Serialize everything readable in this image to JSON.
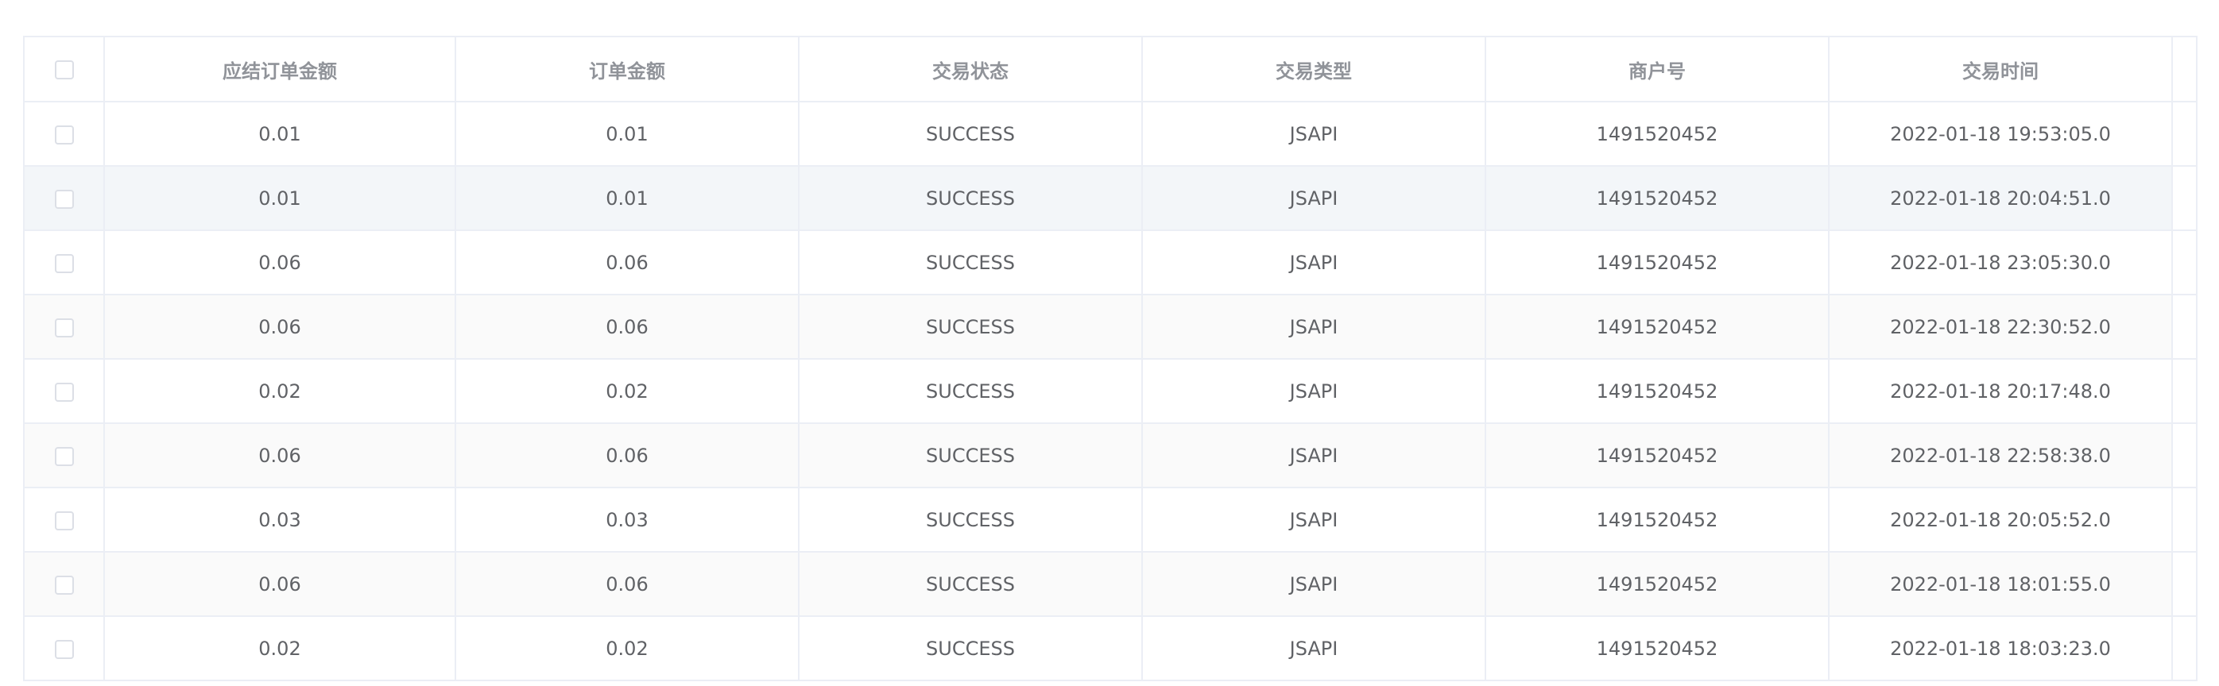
{
  "table": {
    "headers": [
      "应结订单金额",
      "订单金额",
      "交易状态",
      "交易类型",
      "商户号",
      "交易时间"
    ],
    "rows": [
      {
        "settlement_amount": "0.01",
        "order_amount": "0.01",
        "status": "SUCCESS",
        "trade_type": "JSAPI",
        "merchant_id": "1491520452",
        "trade_time": "2022-01-18 19:53:05.0"
      },
      {
        "settlement_amount": "0.01",
        "order_amount": "0.01",
        "status": "SUCCESS",
        "trade_type": "JSAPI",
        "merchant_id": "1491520452",
        "trade_time": "2022-01-18 20:04:51.0"
      },
      {
        "settlement_amount": "0.06",
        "order_amount": "0.06",
        "status": "SUCCESS",
        "trade_type": "JSAPI",
        "merchant_id": "1491520452",
        "trade_time": "2022-01-18 23:05:30.0"
      },
      {
        "settlement_amount": "0.06",
        "order_amount": "0.06",
        "status": "SUCCESS",
        "trade_type": "JSAPI",
        "merchant_id": "1491520452",
        "trade_time": "2022-01-18 22:30:52.0"
      },
      {
        "settlement_amount": "0.02",
        "order_amount": "0.02",
        "status": "SUCCESS",
        "trade_type": "JSAPI",
        "merchant_id": "1491520452",
        "trade_time": "2022-01-18 20:17:48.0"
      },
      {
        "settlement_amount": "0.06",
        "order_amount": "0.06",
        "status": "SUCCESS",
        "trade_type": "JSAPI",
        "merchant_id": "1491520452",
        "trade_time": "2022-01-18 22:58:38.0"
      },
      {
        "settlement_amount": "0.03",
        "order_amount": "0.03",
        "status": "SUCCESS",
        "trade_type": "JSAPI",
        "merchant_id": "1491520452",
        "trade_time": "2022-01-18 20:05:52.0"
      },
      {
        "settlement_amount": "0.06",
        "order_amount": "0.06",
        "status": "SUCCESS",
        "trade_type": "JSAPI",
        "merchant_id": "1491520452",
        "trade_time": "2022-01-18 18:01:55.0"
      },
      {
        "settlement_amount": "0.02",
        "order_amount": "0.02",
        "status": "SUCCESS",
        "trade_type": "JSAPI",
        "merchant_id": "1491520452",
        "trade_time": "2022-01-18 18:03:23.0"
      }
    ],
    "colors": {
      "border": "#ebeef5",
      "header_text": "#909399",
      "cell_text": "#606266",
      "stripe": "#fafafa",
      "hover_row": "#f3f6f9",
      "checkbox_border": "#dcdfe6"
    }
  }
}
